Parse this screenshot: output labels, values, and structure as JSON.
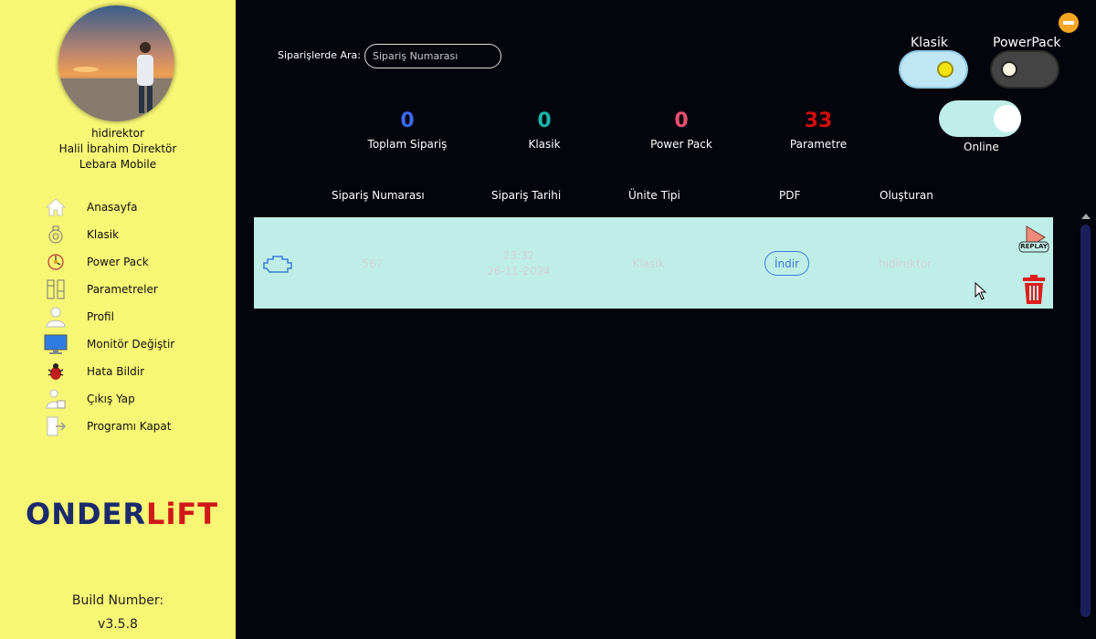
{
  "sidebar": {
    "username": "hidirektor",
    "full_name": "Halil İbrahim Direktör",
    "company": "Lebara Mobile",
    "items": [
      {
        "label": "Anasayfa",
        "icon": "home-icon"
      },
      {
        "label": "Klasik",
        "icon": "klasik-icon"
      },
      {
        "label": "Power Pack",
        "icon": "power-pack-icon"
      },
      {
        "label": "Parametreler",
        "icon": "parameters-icon"
      },
      {
        "label": "Profil",
        "icon": "profile-icon"
      },
      {
        "label": "Monitör Değiştir",
        "icon": "monitor-icon"
      },
      {
        "label": "Hata Bildir",
        "icon": "bug-icon"
      },
      {
        "label": "Çıkış Yap",
        "icon": "logout-icon"
      },
      {
        "label": "Programı Kapat",
        "icon": "exit-icon"
      }
    ],
    "brand_left": "ONDER",
    "brand_right": "LiFT",
    "build_label": "Build Number:",
    "build_version": "v3.5.8"
  },
  "search": {
    "label": "Siparişlerde Ara:",
    "placeholder": "Sipariş Numarası"
  },
  "stats": [
    {
      "value": "0",
      "label": "Toplam Sipariş",
      "color": "#3a6bf0"
    },
    {
      "value": "0",
      "label": "Klasik",
      "color": "#19b5a8"
    },
    {
      "value": "0",
      "label": "Power Pack",
      "color": "#ee4f73"
    },
    {
      "value": "33",
      "label": "Parametre",
      "color": "#d30c0c"
    }
  ],
  "toggles": {
    "klasik_label": "Klasik",
    "powerpack_label": "PowerPack",
    "online_label": "Online",
    "klasik_on": true,
    "powerpack_on": false,
    "online_on": true
  },
  "table": {
    "headers": [
      "Sipariş Numarası",
      "Sipariş Tarihi",
      "Ünite Tipi",
      "PDF",
      "Oluşturan"
    ],
    "rows": [
      {
        "order_no": "567",
        "time": "23:32",
        "date": "26-11-2024",
        "unit_type": "Klasik",
        "pdf_button": "İndir",
        "creator": "hidirektor",
        "replay_label": "REPLAY"
      }
    ]
  },
  "colors": {
    "sidebar_bg": "#f7f675",
    "main_bg": "#04040c",
    "row_bg": "#bfeee8",
    "accent_blue": "#3a7bd5",
    "delete_red": "#e01b1b",
    "minimize_orange": "#f5a623"
  }
}
